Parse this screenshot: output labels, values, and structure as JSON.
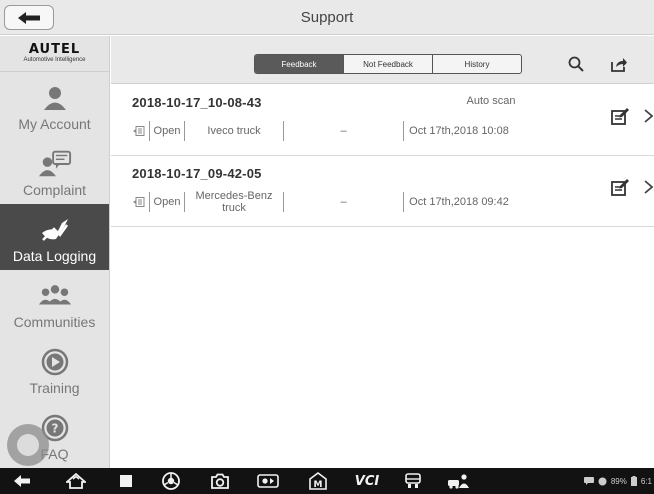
{
  "window": {
    "title": "Support"
  },
  "brand": {
    "name": "AUTEL",
    "tagline": "Automotive Intelligence"
  },
  "sidebar": {
    "items": [
      {
        "label": "My Account",
        "icon": "account-icon",
        "active": false
      },
      {
        "label": "Complaint",
        "icon": "complaint-icon",
        "active": false
      },
      {
        "label": "Data Logging",
        "icon": "data-logging-icon",
        "active": true
      },
      {
        "label": "Communities",
        "icon": "communities-icon",
        "active": false
      },
      {
        "label": "Training",
        "icon": "play-circle-icon",
        "active": false
      },
      {
        "label": "FAQ",
        "icon": "question-circle-icon",
        "active": false
      }
    ]
  },
  "toolbar": {
    "tabs": [
      {
        "label": "Feedback",
        "active": true
      },
      {
        "label": "Not Feedback",
        "active": false
      },
      {
        "label": "History",
        "active": false
      }
    ],
    "search_icon": "search-icon",
    "share_icon": "share-icon"
  },
  "records": [
    {
      "name": "2018-10-17_10-08-43",
      "note": "Auto scan",
      "status": "Open",
      "vehicle": "Iveco truck",
      "dash": "–",
      "date": "Oct 17th,2018 10:08"
    },
    {
      "name": "2018-10-17_09-42-05",
      "note": "",
      "status": "Open",
      "vehicle": "Mercedes-Benz truck",
      "dash": "–",
      "date": "Oct 17th,2018 09:42"
    }
  ],
  "system_bar": {
    "vci_label": "VCI",
    "battery": "89%",
    "clock": "6:1"
  },
  "colors": {
    "active_nav": "#4a4a4a",
    "active_tab": "#5a5a5a",
    "system_bar": "#121212"
  }
}
